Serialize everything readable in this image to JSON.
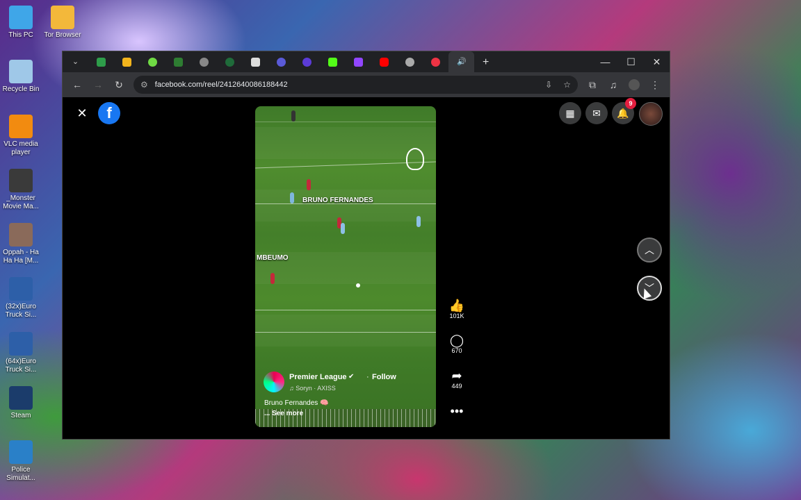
{
  "desktop": {
    "icons": [
      {
        "label": "This PC",
        "color": "#3fa6e8"
      },
      {
        "label": "Tor Browser",
        "color": "#f3b83a"
      },
      {
        "label": "Recycle Bin",
        "color": "#9fc8e8"
      },
      {
        "label": "VLC media player",
        "color": "#f28b10"
      },
      {
        "label": "_Monster Movie Ma...",
        "color": "#3a3a3a"
      },
      {
        "label": "Oppah - Ha Ha Ha [M...",
        "color": "#8a6a5a"
      },
      {
        "label": "(32x)Euro Truck Si...",
        "color": "#2d5fa8"
      },
      {
        "label": "(64x)Euro Truck Si...",
        "color": "#2d5fa8"
      },
      {
        "label": "Steam",
        "color": "#1b3c6b"
      },
      {
        "label": "Police Simulat...",
        "color": "#2a80c8"
      }
    ]
  },
  "browser": {
    "url": "facebook.com/reel/2412640086188442",
    "win": {
      "minimize": "—",
      "maximize": "☐",
      "close": "✕"
    }
  },
  "reel": {
    "overlay_labels": [
      "BRUNO FERNANDES",
      "MBEUMO"
    ],
    "author": "Premier League",
    "follow": "Follow",
    "separator": "·",
    "music": "♫ Soryn · AXISS",
    "caption": "Bruno Fernandes 🧠",
    "see_more": "... See more",
    "likes": "101K",
    "comments": "670",
    "shares": "449",
    "notifications": "9"
  },
  "colors": {
    "facebook": "#1877f2",
    "badge": "#e41e3f"
  }
}
